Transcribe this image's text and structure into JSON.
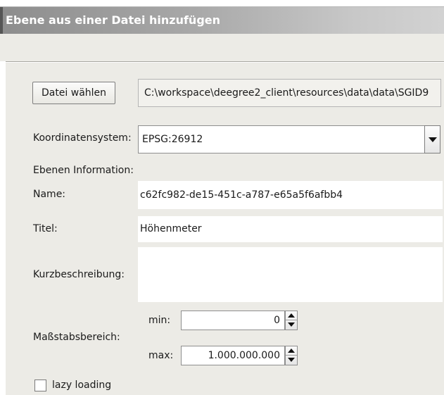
{
  "window": {
    "title": "Ebene aus einer Datei hinzufügen"
  },
  "file": {
    "choose_button": "Datei wählen",
    "path": "C:\\workspace\\deegree2_client\\resources\\data\\data\\SGID9"
  },
  "crs": {
    "label": "Koordinatensystem:",
    "value": "EPSG:26912"
  },
  "layer_info": {
    "heading": "Ebenen Information:",
    "name_label": "Name:",
    "name_value": "c62fc982-de15-451c-a787-e65a5f6afbb4",
    "title_label": "Titel:",
    "title_value": "Höhenmeter",
    "abstract_label": "Kurzbeschreibung:",
    "abstract_value": ""
  },
  "scale": {
    "label": "Maßstabsbereich:",
    "min_label": "min:",
    "min_value": "0",
    "max_label": "max:",
    "max_value": "1.000.000.000"
  },
  "lazy_loading": {
    "label": "lazy loading",
    "checked": false
  }
}
